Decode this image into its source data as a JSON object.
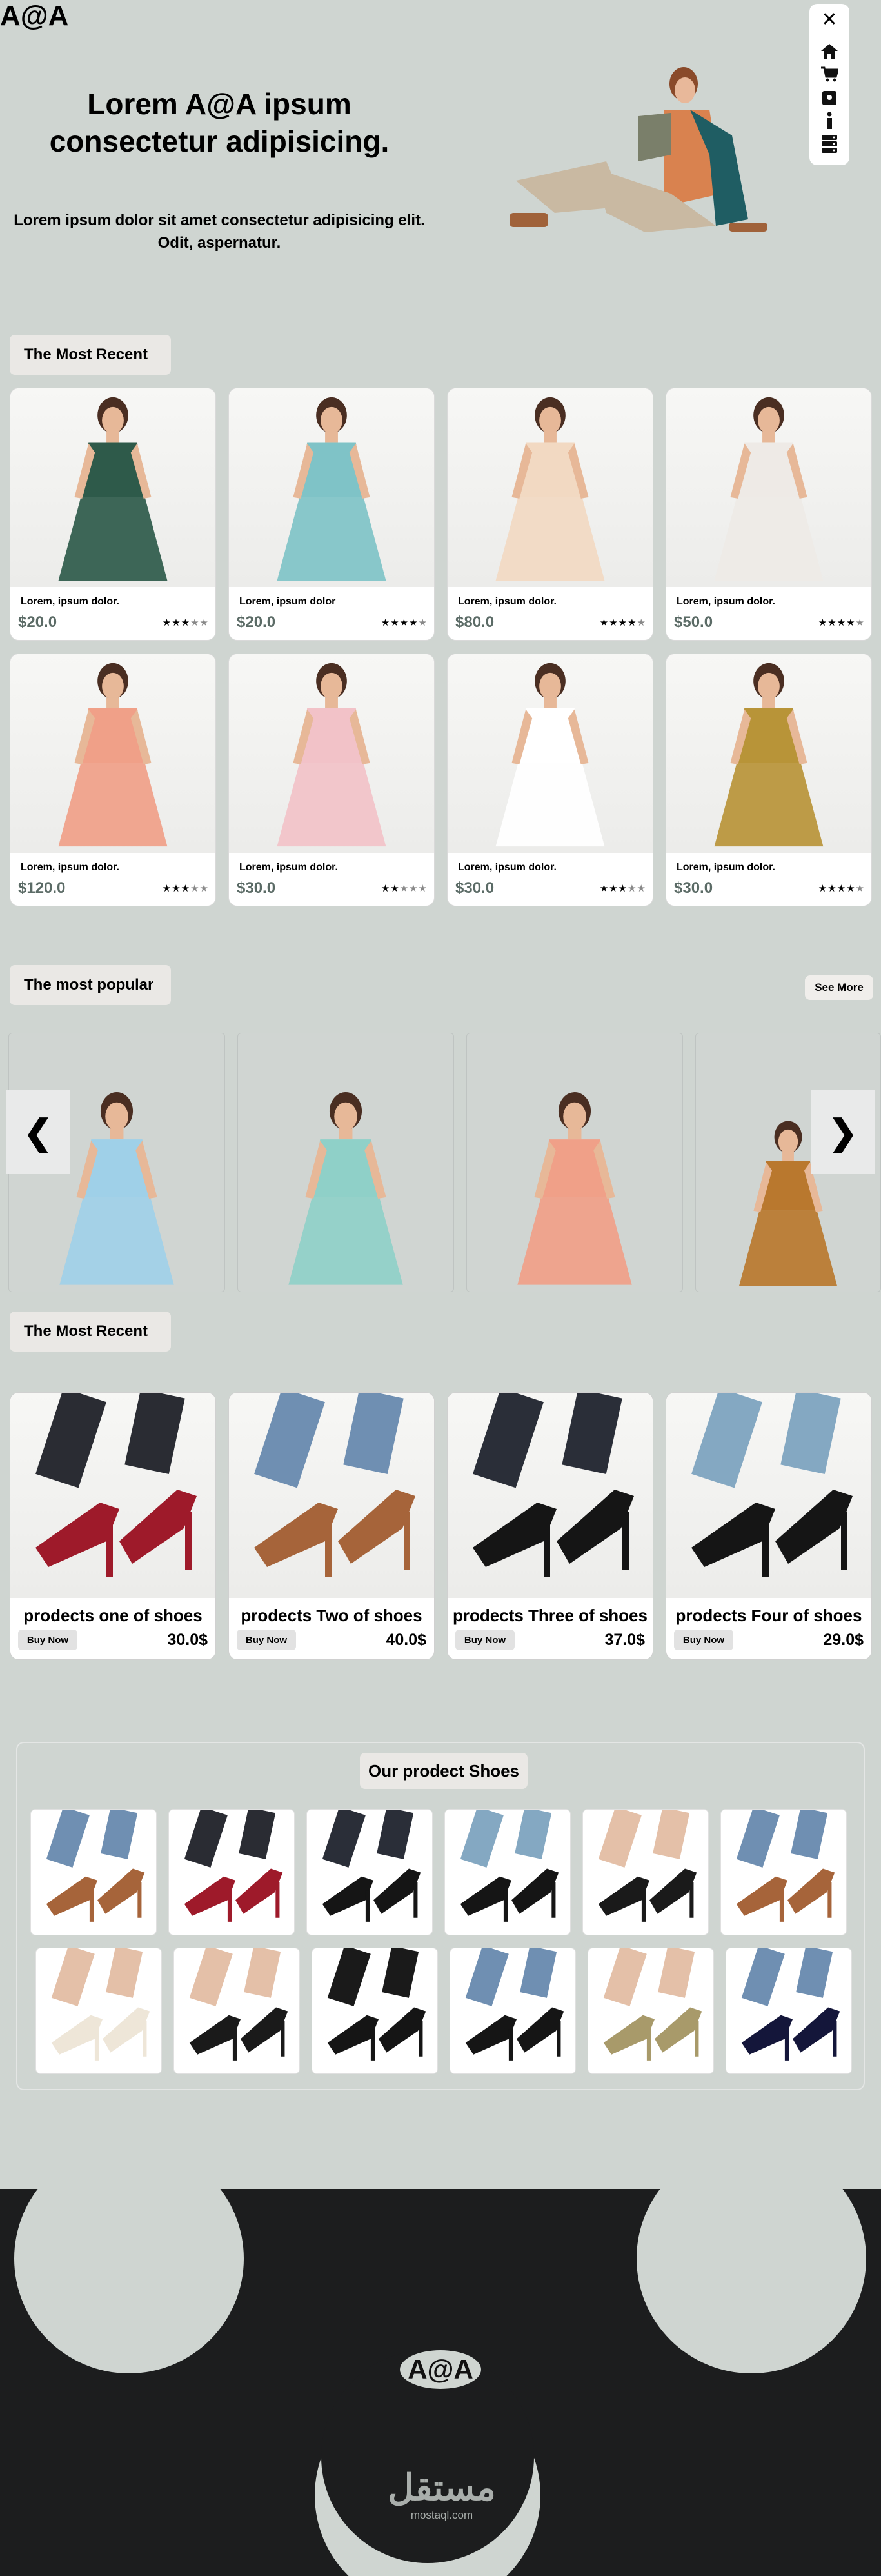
{
  "header": {
    "logo": "A@A",
    "nav_close": "✕",
    "nav_icons": [
      "home-icon",
      "cart-icon",
      "gift-icon",
      "info-icon",
      "server-icon"
    ]
  },
  "hero": {
    "title": "Lorem A@A ipsum consectetur adipisicing.",
    "subtitle": "Lorem ipsum dolor sit amet consectetur adipisicing elit. Odit, aspernatur."
  },
  "recent": {
    "tag": "The Most Recent",
    "items": [
      {
        "name": "Lorem, ipsum dolor.",
        "price": "$20.0",
        "rating": 3,
        "color": "#c76a3a",
        "dress": "#2e5a4a"
      },
      {
        "name": "Lorem, ipsum dolor",
        "price": "$20.0",
        "rating": 4,
        "color": "#d14a6a",
        "dress": "#7fc3c7"
      },
      {
        "name": "Lorem, ipsum dolor.",
        "price": "$80.0",
        "rating": 4,
        "color": "#e86a7a",
        "dress": "#f2d9c2"
      },
      {
        "name": "Lorem, ipsum dolor.",
        "price": "$50.0",
        "rating": 4,
        "color": "#d9d2cf",
        "dress": "#eeeae6"
      },
      {
        "name": "Lorem, ipsum dolor.",
        "price": "$120.0",
        "rating": 3,
        "color": "#e89c80",
        "dress": "#f0a088"
      },
      {
        "name": "Lorem, ipsum dolor.",
        "price": "$30.0",
        "rating": 2,
        "color": "#e4a4b2",
        "dress": "#f2c2c8"
      },
      {
        "name": "Lorem, ipsum dolor.",
        "price": "$30.0",
        "rating": 3,
        "color": "#f4f4f2",
        "dress": "#ffffff"
      },
      {
        "name": "Lorem, ipsum dolor.",
        "price": "$30.0",
        "rating": 4,
        "color": "#a2842a",
        "dress": "#b89438"
      }
    ]
  },
  "popular": {
    "tag": "The most popular",
    "see_more": "See More",
    "prev": "❮",
    "next": "❯",
    "items": [
      {
        "dress": "#9fd0e8"
      },
      {
        "dress": "#8fd0c8"
      },
      {
        "dress": "#f0a088"
      },
      {
        "dress": "#b9782e"
      }
    ]
  },
  "shoes": {
    "tag": "The Most Recent",
    "buy_label": "Buy Now",
    "items": [
      {
        "name": "prodects one of shoes",
        "price": "30.0$",
        "shoe": "#9e1a2a",
        "leg": "#2a2c33"
      },
      {
        "name": "prodects Two of shoes",
        "price": "40.0$",
        "shoe": "#a6643a",
        "leg": "#6f8fb2"
      },
      {
        "name": "prodects Three of shoes",
        "price": "37.0$",
        "shoe": "#151515",
        "leg": "#2a2e38"
      },
      {
        "name": "prodects Four of shoes",
        "price": "29.0$",
        "shoe": "#151515",
        "leg": "#84a8c2"
      }
    ]
  },
  "gallery": {
    "title": "Our prodect Shoes",
    "thumbs": [
      {
        "shoe": "#a6643a",
        "leg": "#6f8fb2"
      },
      {
        "shoe": "#9e1a2a",
        "leg": "#2a2c33"
      },
      {
        "shoe": "#151515",
        "leg": "#2a2e38"
      },
      {
        "shoe": "#151515",
        "leg": "#84a8c2"
      },
      {
        "shoe": "#1a1a1a",
        "leg": "#e4c0a8"
      },
      {
        "shoe": "#a6643a",
        "leg": "#6f8fb2"
      },
      {
        "shoe": "#eee6d8",
        "leg": "#e4c0a8"
      },
      {
        "shoe": "#1a1a1a",
        "leg": "#e4c0a8"
      },
      {
        "shoe": "#151515",
        "leg": "#1a1a1a"
      },
      {
        "shoe": "#151515",
        "leg": "#6f8fb2"
      },
      {
        "shoe": "#a89a6a",
        "leg": "#e4c0a8"
      },
      {
        "shoe": "#14163a",
        "leg": "#6f8fb2"
      }
    ]
  },
  "footer": {
    "logo": "A@A",
    "watermark_ar": "مستقل",
    "watermark_en": "mostaql.com"
  }
}
